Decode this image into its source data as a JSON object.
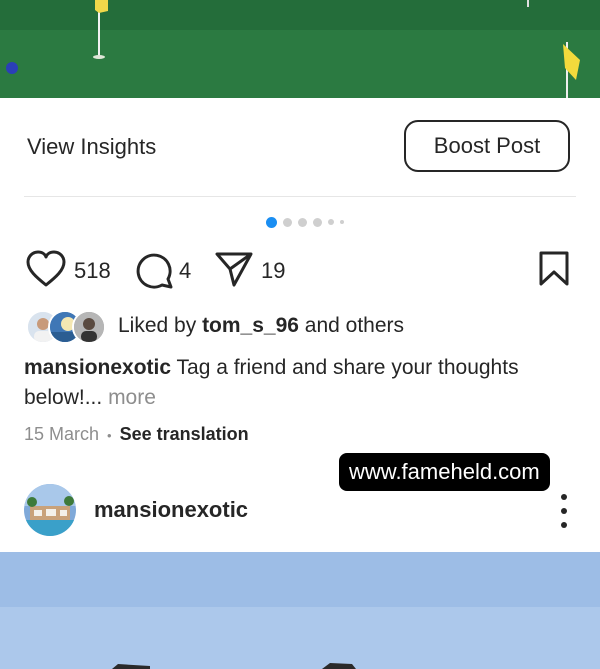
{
  "top_post": {
    "view_insights_label": "View Insights",
    "boost_post_label": "Boost Post",
    "carousel": {
      "total_slides": 6,
      "current_slide": 1
    },
    "actions": {
      "likes_count": "518",
      "comments_count": "4",
      "shares_count": "19"
    },
    "liked_by": {
      "prefix": "Liked by",
      "user": "tom_s_96",
      "suffix": "and others"
    },
    "caption": {
      "username": "mansionexotic",
      "text": "Tag a friend and share your thoughts below!...",
      "more_label": "more"
    },
    "date": "15 March",
    "separator": "•",
    "see_translation_label": "See translation"
  },
  "watermark": "www.fameheld.com",
  "next_post": {
    "username": "mansionexotic"
  },
  "colors": {
    "text": "#262626",
    "secondary_text": "#8e8e8e",
    "accent_dot": "#1a8ef2",
    "divider": "#e6e6e6",
    "watermark_bg": "#000000"
  },
  "icons": [
    "heart-icon",
    "comment-icon",
    "share-icon",
    "bookmark-icon",
    "more-options-icon"
  ]
}
